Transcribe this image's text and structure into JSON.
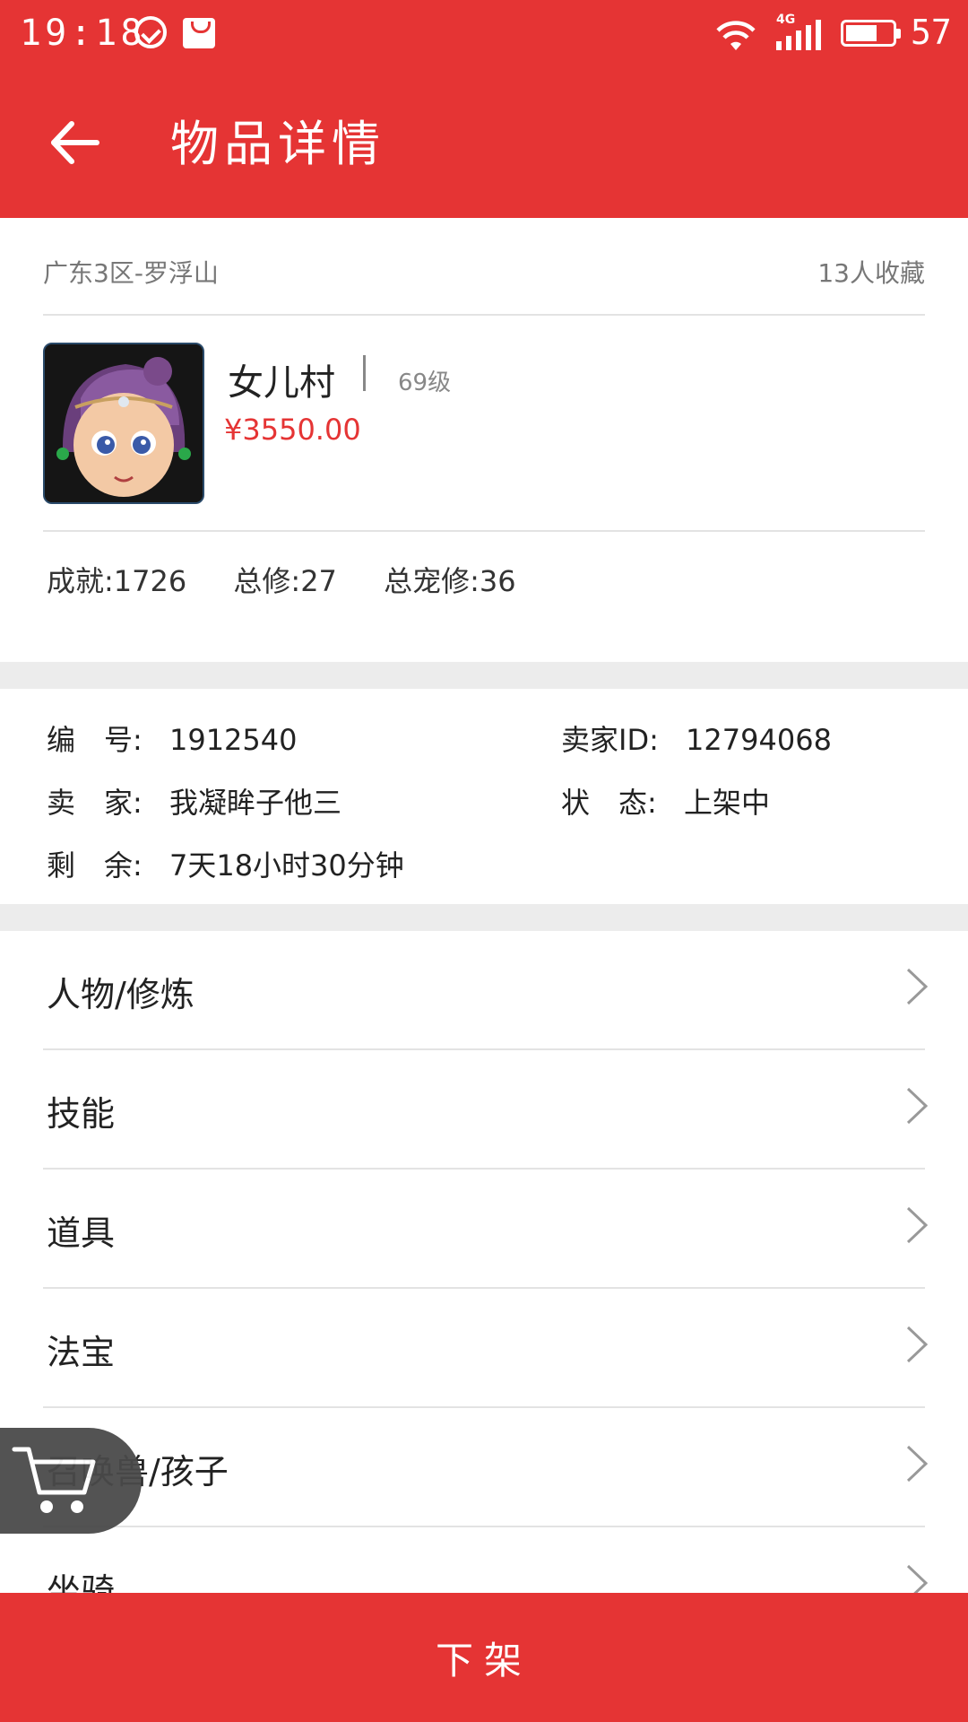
{
  "status_bar": {
    "time": "19:18",
    "network": "4G",
    "battery_level": "57",
    "icons": [
      "check-circle-icon",
      "shopping-bag-icon",
      "wifi-icon",
      "signal-icon",
      "battery-icon"
    ]
  },
  "app_bar": {
    "title": "物品详情",
    "back_icon": "arrow-left-icon"
  },
  "summary": {
    "region": "广东3区-罗浮山",
    "favorites": "13人收藏",
    "role_name": "女儿村",
    "role_level": "69级",
    "price": "¥3550.00",
    "stats": {
      "achievement": "成就:1726",
      "total_cultivation": "总修:27",
      "total_pet_cultivation": "总宠修:36"
    }
  },
  "details": {
    "id_label": "编　号:",
    "id_value": "1912540",
    "seller_id_label": "卖家ID:",
    "seller_id_value": "12794068",
    "seller_label": "卖　家:",
    "seller_value": "我凝眸子他三",
    "status_label": "状　态:",
    "status_value": "上架中",
    "remaining_label": "剩　余:",
    "remaining_value": "7天18小时30分钟"
  },
  "menu": {
    "items": [
      {
        "label": "人物/修炼"
      },
      {
        "label": "技能"
      },
      {
        "label": "道具"
      },
      {
        "label": "法宝"
      },
      {
        "label": "召唤兽/孩子"
      },
      {
        "label": "坐骑"
      }
    ]
  },
  "bottom_action": {
    "label": "下架"
  },
  "colors": {
    "primary": "#e53434",
    "divider": "#e3e3e3",
    "gap": "#ececec"
  }
}
